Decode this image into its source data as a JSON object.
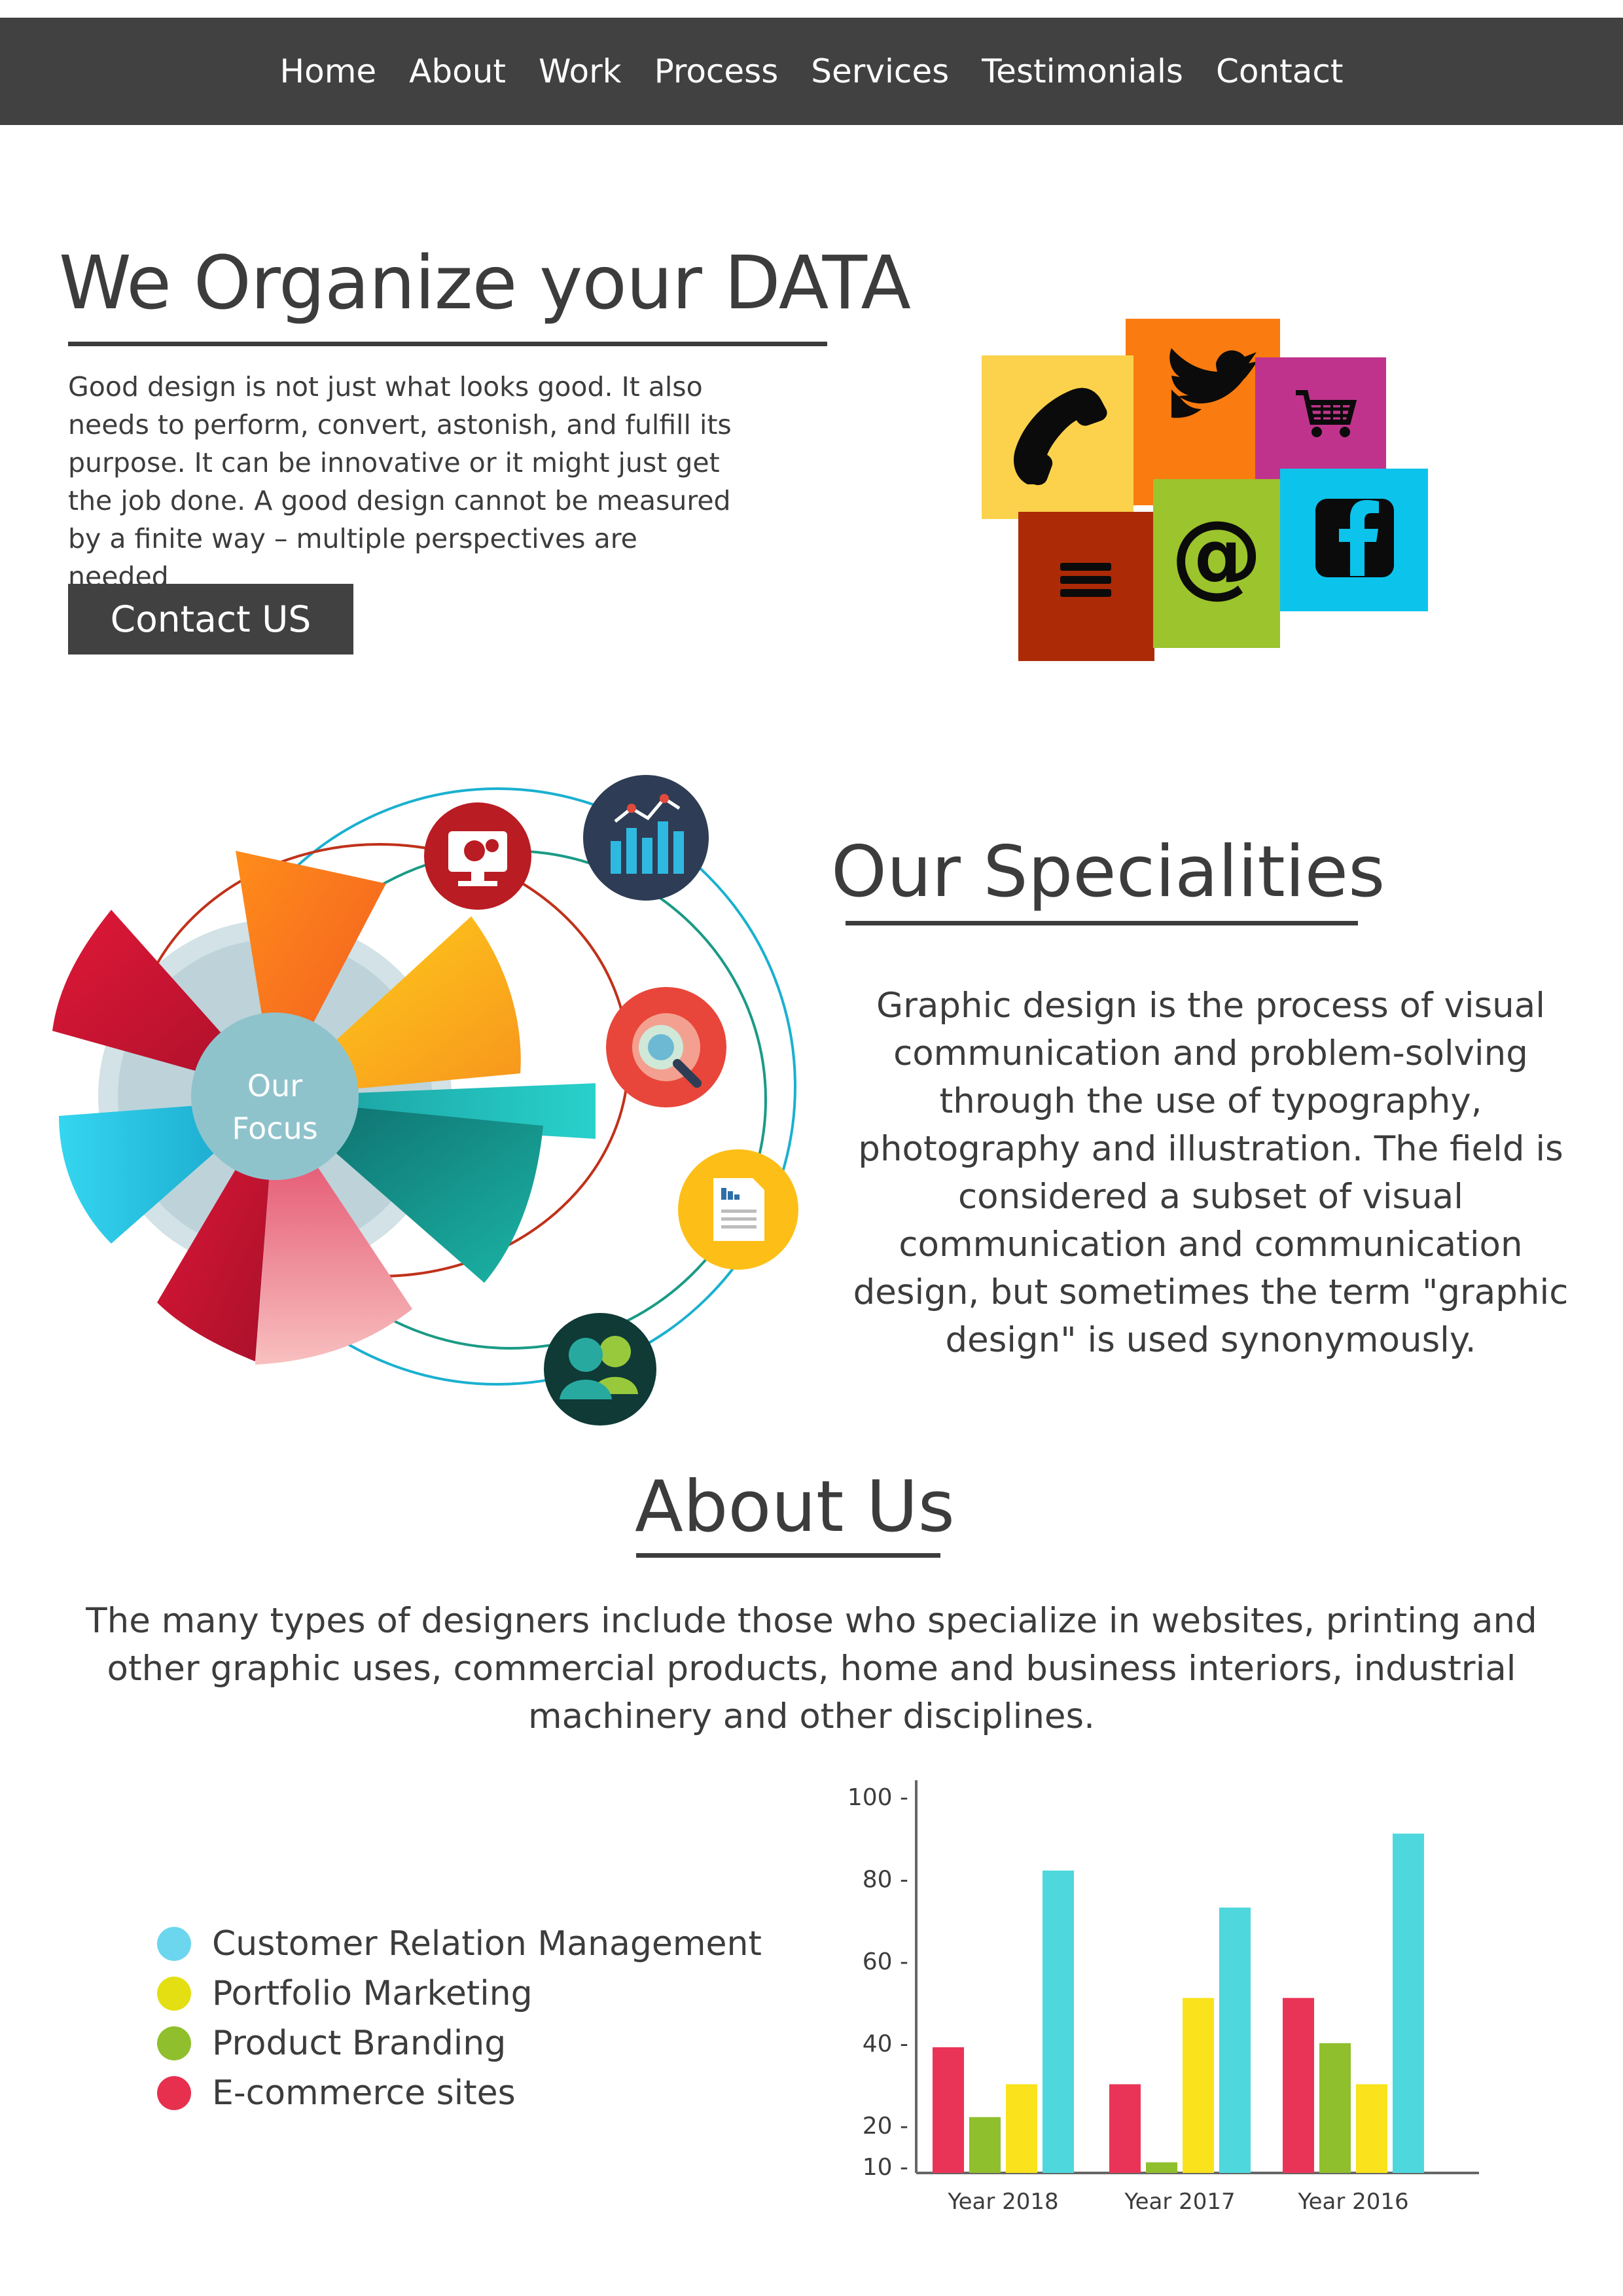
{
  "nav": {
    "items": [
      "Home",
      "About",
      "Work",
      "Process",
      "Services",
      "Testimonials",
      "Contact"
    ]
  },
  "hero": {
    "title": "We Organize your DATA",
    "text": "Good design is not just what looks good. It also needs to perform, convert, astonish, and fulfill its purpose. It can be innovative or it might just get the job done. A good design cannot be measured by a finite way – multiple perspectives are needed",
    "button": "Contact US",
    "tiles": [
      {
        "icon": "phone-icon",
        "color": "#fcd24c"
      },
      {
        "icon": "twitter-icon",
        "color": "#fa7b0f"
      },
      {
        "icon": "cart-icon",
        "color": "#c0338c"
      },
      {
        "icon": "menu-icon",
        "color": "#ad2a07"
      },
      {
        "icon": "at-icon",
        "color": "#9cc42c"
      },
      {
        "icon": "facebook-icon",
        "color": "#0cc3ec"
      }
    ]
  },
  "focus": {
    "center_line1": "Our",
    "center_line2": "Focus",
    "icons": [
      "settings-monitor-icon",
      "bar-chart-icon",
      "search-chart-icon",
      "document-icon",
      "users-icon"
    ]
  },
  "specialities": {
    "title": "Our Specialities",
    "text": "Graphic design is the process of visual communication and problem-solving through the use of typography, photography and illustration. The field is considered a subset of visual communication and communication design, but sometimes the term \"graphic design\" is used synonymously."
  },
  "about": {
    "title": "About Us",
    "text": "The many types of designers include those who specialize in websites, printing and other graphic uses, commercial products, home and business interiors, industrial machinery and other disciplines."
  },
  "legend": [
    {
      "label": "Customer Relation Management",
      "color": "#6cd6ef"
    },
    {
      "label": "Portfolio Marketing",
      "color": "#e3df12"
    },
    {
      "label": "Product Branding",
      "color": "#8fbf2c"
    },
    {
      "label": "E-commerce sites",
      "color": "#e7304e"
    }
  ],
  "chart_data": {
    "type": "bar",
    "categories": [
      "Year 2018",
      "Year 2017",
      "Year 2016"
    ],
    "yticks": [
      "100 -",
      "80 -",
      "60 -",
      "40 -",
      "20 -",
      "10 -"
    ],
    "ylim": [
      0,
      100
    ],
    "series": [
      {
        "color": "#ea3457",
        "values": [
          39,
          30,
          51
        ]
      },
      {
        "color": "#8fbf2c",
        "values": [
          22,
          11,
          40
        ]
      },
      {
        "color": "#fae21c",
        "values": [
          30,
          51,
          30
        ]
      },
      {
        "color": "#4ed8dd",
        "values": [
          82,
          73,
          91
        ]
      }
    ]
  }
}
